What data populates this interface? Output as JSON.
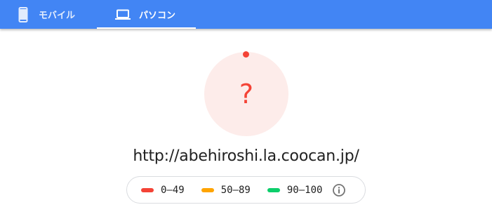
{
  "tabs": [
    {
      "label": "モバイル",
      "icon": "smartphone-icon",
      "selected": false
    },
    {
      "label": "パソコン",
      "icon": "laptop-icon",
      "selected": true
    }
  ],
  "colors": {
    "tabbar": "#4285f4",
    "fail": "#f44336",
    "fail_bg": "#fdecea",
    "average": "#ffa400",
    "pass": "#0cce6b"
  },
  "score": {
    "display": "?",
    "status": "error"
  },
  "url": "http://abehiroshi.la.coocan.jp/",
  "legend": [
    {
      "range": "0–49",
      "color": "#f44336"
    },
    {
      "range": "50–89",
      "color": "#ffa400"
    },
    {
      "range": "90–100",
      "color": "#0cce6b"
    }
  ],
  "legend_info_icon": "info-icon"
}
